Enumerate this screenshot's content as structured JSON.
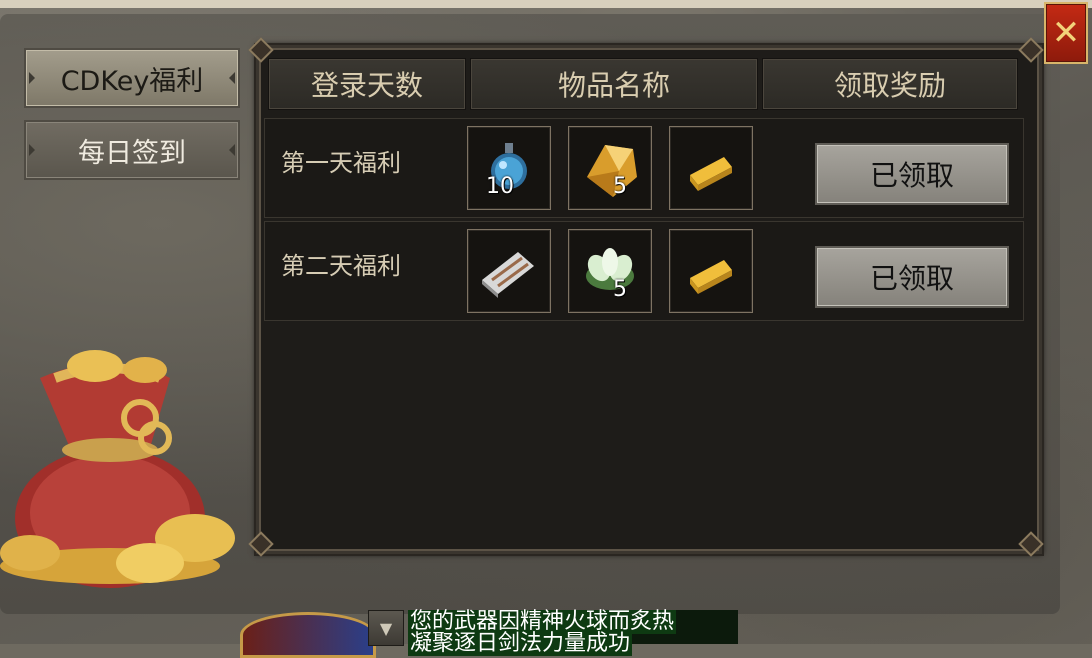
{
  "sidebar": {
    "tabs": [
      {
        "label": "CDKey福利",
        "active": true
      },
      {
        "label": "每日签到",
        "active": false
      }
    ]
  },
  "table": {
    "headers": [
      "登录天数",
      "物品名称",
      "领取奖励"
    ],
    "rows": [
      {
        "label": "第一天福利",
        "items": [
          {
            "icon": "blue-potion-icon",
            "count": "10"
          },
          {
            "icon": "gold-crystal-icon",
            "count": "5"
          },
          {
            "icon": "gold-bar-icon",
            "count": ""
          }
        ],
        "button": "已领取"
      },
      {
        "label": "第二天福利",
        "items": [
          {
            "icon": "scroll-icon",
            "count": ""
          },
          {
            "icon": "lotus-icon",
            "count": "5"
          },
          {
            "icon": "gold-bar-icon",
            "count": ""
          }
        ],
        "button": "已领取"
      }
    ]
  },
  "close_label": "✕",
  "chat": {
    "line1": "您的武器因精神火球而炙热",
    "line2": "凝聚逐日剑法力量成功"
  },
  "colors": {
    "accent_gold": "#d9a43a",
    "close_red": "#b32211",
    "header_text": "#d9cdb0"
  }
}
